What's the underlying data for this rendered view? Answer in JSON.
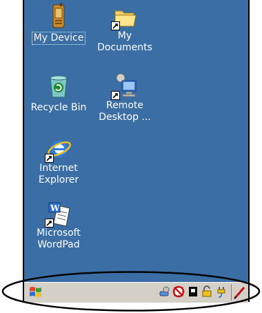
{
  "desktop": {
    "icons": [
      {
        "id": "my-device",
        "label": "My Device",
        "selected": true
      },
      {
        "id": "my-documents",
        "label": "My\nDocuments"
      },
      {
        "id": "recycle-bin",
        "label": "Recycle Bin"
      },
      {
        "id": "remote-desktop",
        "label": "Remote\nDesktop ..."
      },
      {
        "id": "internet-explorer",
        "label": "Internet\nExplorer"
      },
      {
        "id": "microsoft-wordpad",
        "label": "Microsoft\nWordPad"
      }
    ]
  },
  "taskbar": {
    "start_icon": "windows-flag-icon",
    "tray_icons": [
      "network-icon",
      "no-signal-icon",
      "card-icon",
      "lock-icon",
      "power-plug-icon"
    ],
    "pen_icon": "pen-icon"
  },
  "colors": {
    "desktop": "#3a6ea5",
    "taskbar": "#d4d0c8",
    "label_text": "#ffffff"
  }
}
